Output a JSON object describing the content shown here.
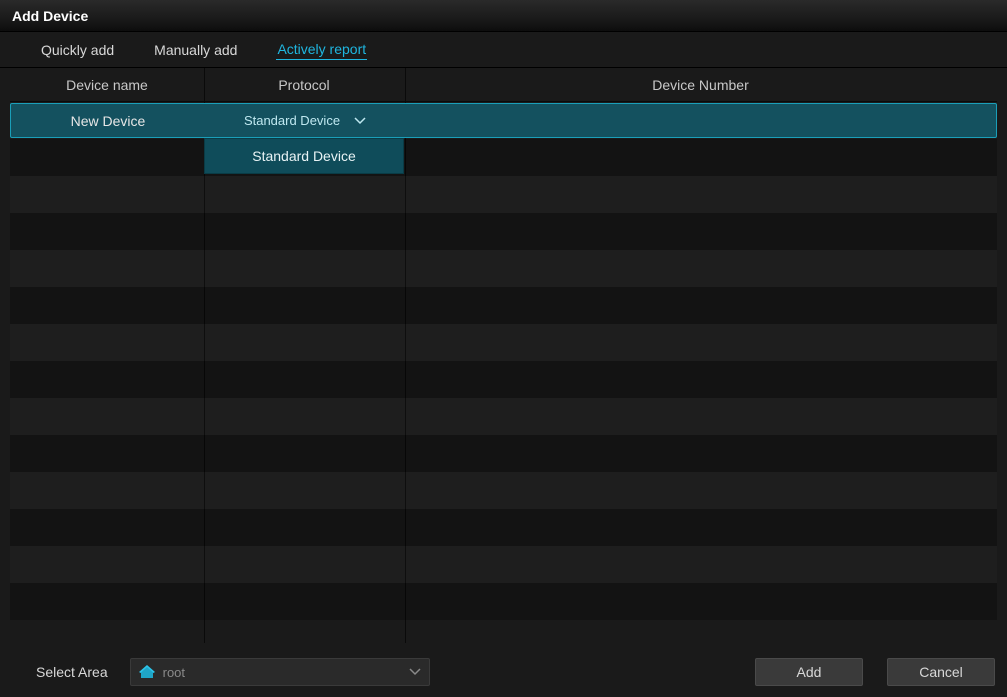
{
  "title": "Add Device",
  "tabs": [
    {
      "label": "Quickly add",
      "active": false
    },
    {
      "label": "Manually add",
      "active": false
    },
    {
      "label": "Actively report",
      "active": true
    }
  ],
  "table": {
    "columns": {
      "device_name": "Device name",
      "protocol": "Protocol",
      "device_number": "Device Number"
    },
    "rows": [
      {
        "device_name": "New Device",
        "protocol": "Standard Device",
        "device_number": "",
        "selected": true
      }
    ],
    "protocol_options": [
      "Standard Device"
    ]
  },
  "bottom": {
    "select_area_label": "Select Area",
    "area_value": "root",
    "add_label": "Add",
    "cancel_label": "Cancel"
  }
}
